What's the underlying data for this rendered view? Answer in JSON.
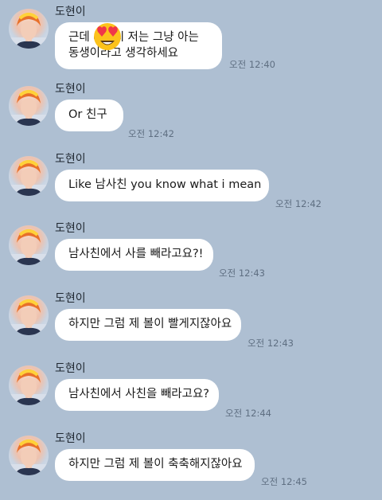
{
  "chat": {
    "messages": [
      {
        "sender": "도현이",
        "lines": [
          "근데 ○○씨 저는 그냥 아는",
          "동생이라고 생각하세요"
        ],
        "time": "오전 12:40"
      },
      {
        "sender": "도현이",
        "lines": [
          "Or 친구"
        ],
        "time": "오전 12:42"
      },
      {
        "sender": "도현이",
        "lines": [
          "Like 남사친 you know what i mean"
        ],
        "time": "오전 12:42"
      },
      {
        "sender": "도현이",
        "lines": [
          "남사친에서 사를 빼라고요?!"
        ],
        "time": "오전 12:43"
      },
      {
        "sender": "도현이",
        "lines": [
          "하지만 그럼 제 볼이 빨게지잖아요"
        ],
        "time": "오전 12:43"
      },
      {
        "sender": "도현이",
        "lines": [
          "남사친에서 사친을 빼라고요?"
        ],
        "time": "오전 12:44"
      },
      {
        "sender": "도현이",
        "lines": [
          "하지만 그럼 제 볼이 축축해지잖아요"
        ],
        "time": "오전 12:45"
      }
    ],
    "overlay_icon": "heart-eyes-emoji-icon"
  },
  "colors": {
    "background": "#aebfd2",
    "bubble": "#ffffff",
    "timestamp": "#5f6f82"
  }
}
